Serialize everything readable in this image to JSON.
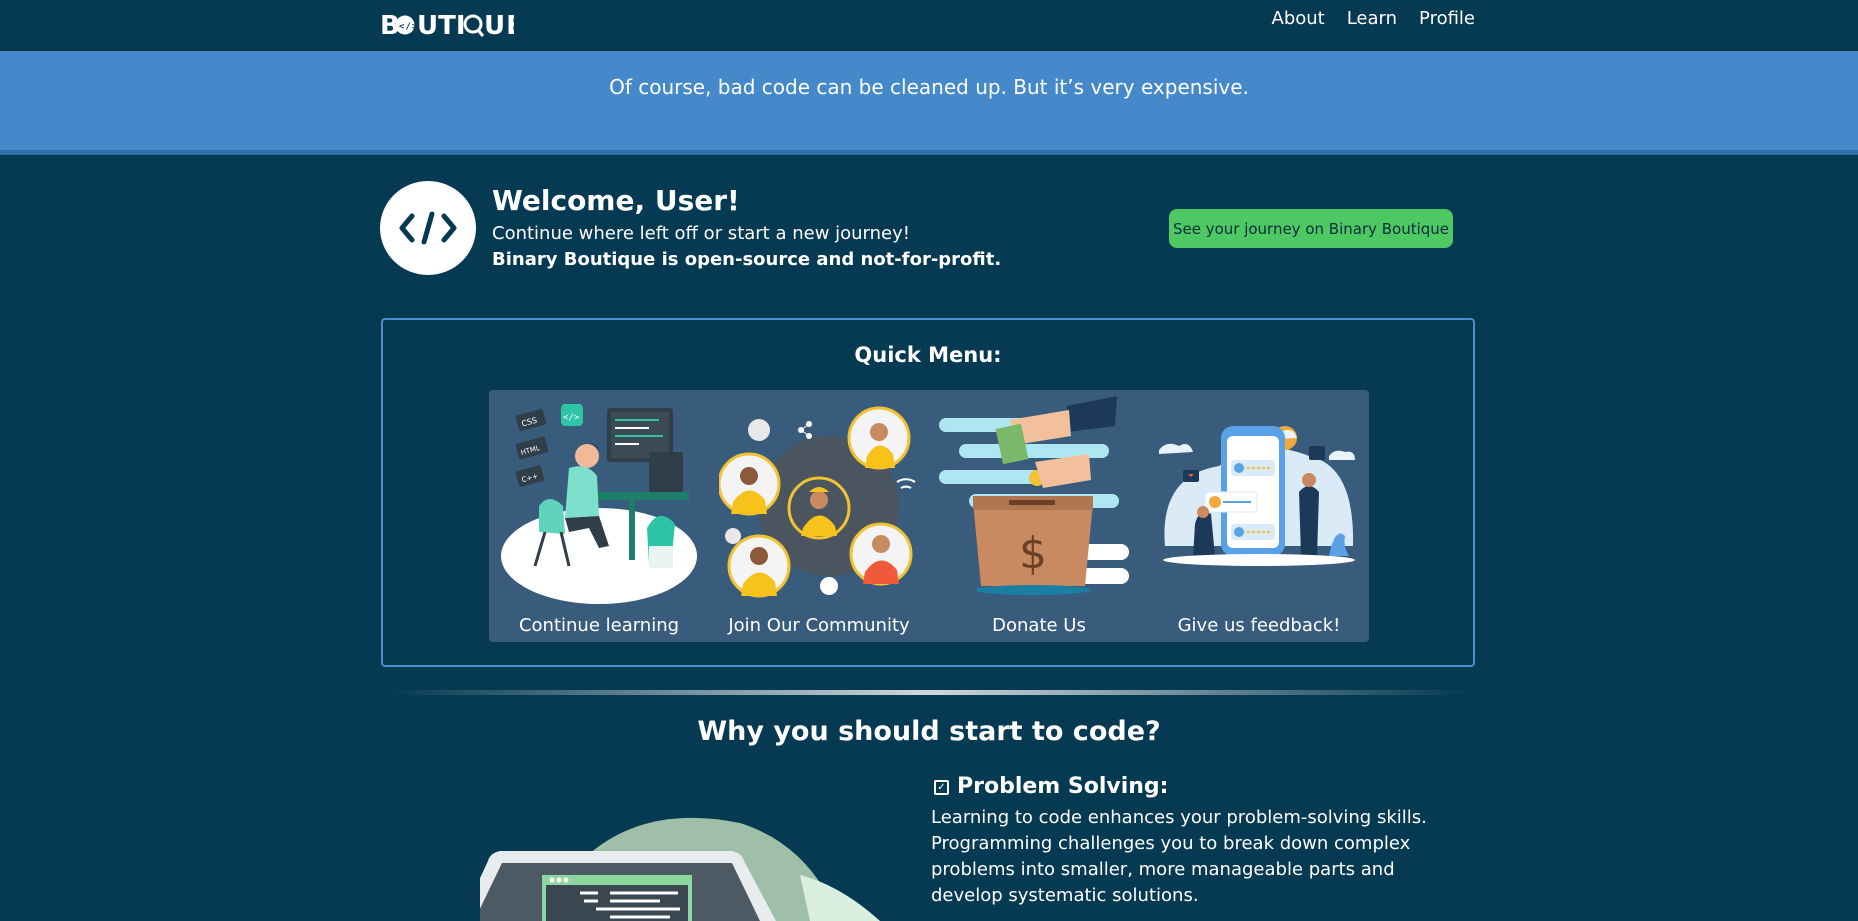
{
  "navbar": {
    "logo_text": "BOUTIQUE",
    "links": [
      "About",
      "Learn",
      "Profile"
    ]
  },
  "banner": {
    "quote": "Of course, bad code can be cleaned up. But it’s very expensive."
  },
  "welcome": {
    "title": "Welcome, User!",
    "subtitle": "Continue where left off or start a new journey!",
    "bold_note": "Binary Boutique is open-source and not-for-profit.",
    "journey_button": "See your journey on Binary Boutique",
    "avatar_icon": "code-icon"
  },
  "quick_menu": {
    "title": "Quick Menu:",
    "cards": [
      {
        "label": "Continue learning",
        "icon": "developer-illustration"
      },
      {
        "label": "Join Our Community",
        "icon": "community-illustration"
      },
      {
        "label": "Donate Us",
        "icon": "donation-box-illustration"
      },
      {
        "label": "Give us feedback!",
        "icon": "feedback-illustration"
      }
    ]
  },
  "why": {
    "title": "Why you should start to code?",
    "point_title": "Problem Solving:",
    "point_text": "Learning to code enhances your problem-solving skills. Programming challenges you to break down complex problems into smaller, more manageable parts and develop systematic solutions."
  },
  "colors": {
    "background": "#053a52",
    "banner": "#4589cb",
    "button": "#4ec862",
    "card_panel": "#3a5c7c",
    "box_border": "#4a8fd6"
  }
}
